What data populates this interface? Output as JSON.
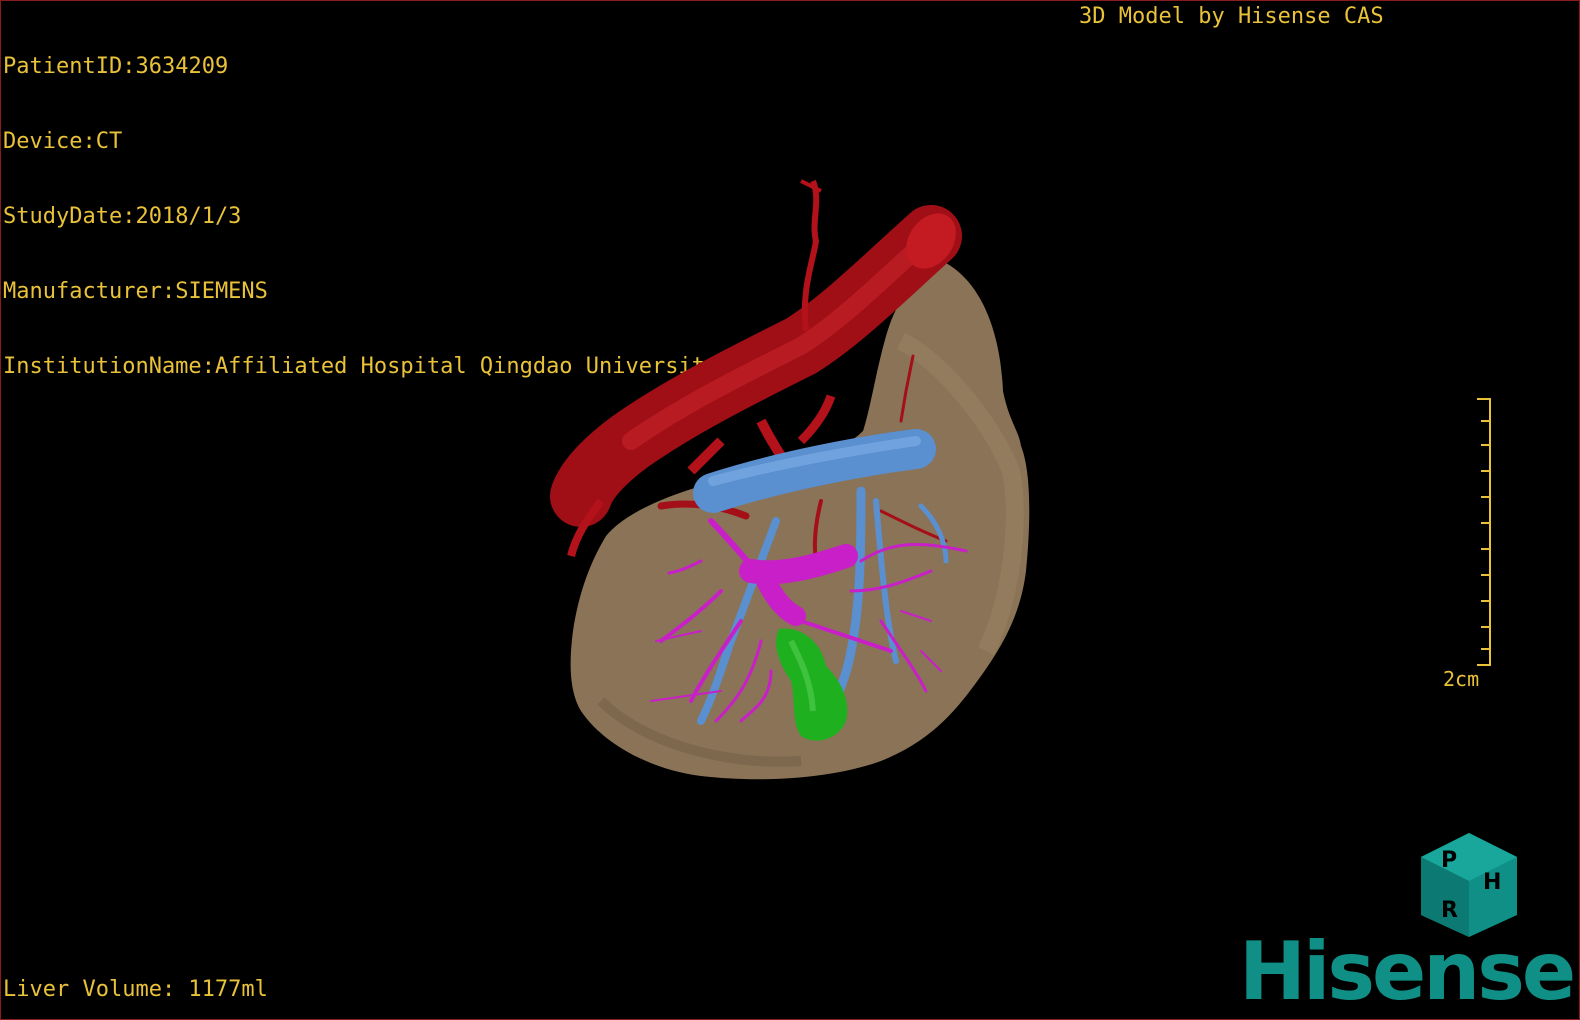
{
  "patient_info": [
    {
      "label": "PatientID",
      "value": "3634209"
    },
    {
      "label": "Device",
      "value": "CT"
    },
    {
      "label": "StudyDate",
      "value": "2018/1/3"
    },
    {
      "label": "Manufacturer",
      "value": "SIEMENS"
    },
    {
      "label": "InstitutionName",
      "value": "Affiliated Hospital Qingdao University-C"
    }
  ],
  "credit_text": "3D Model by Hisense CAS",
  "liver_volume_text": "Liver Volume: 1177ml",
  "scale_bar": {
    "label": "2cm"
  },
  "orientation_cube": {
    "faces": [
      "P",
      "H",
      "R"
    ]
  },
  "brand": {
    "logo_text": "Hisense"
  },
  "colors": {
    "overlay_text": "#e9c23a",
    "liver": "#8a7356",
    "artery": "#b0101a",
    "hepatic_vein": "#5a8fd0",
    "portal_vein": "#c81fc8",
    "gallbladder": "#1fb01f",
    "brand": "#0f8f86"
  }
}
